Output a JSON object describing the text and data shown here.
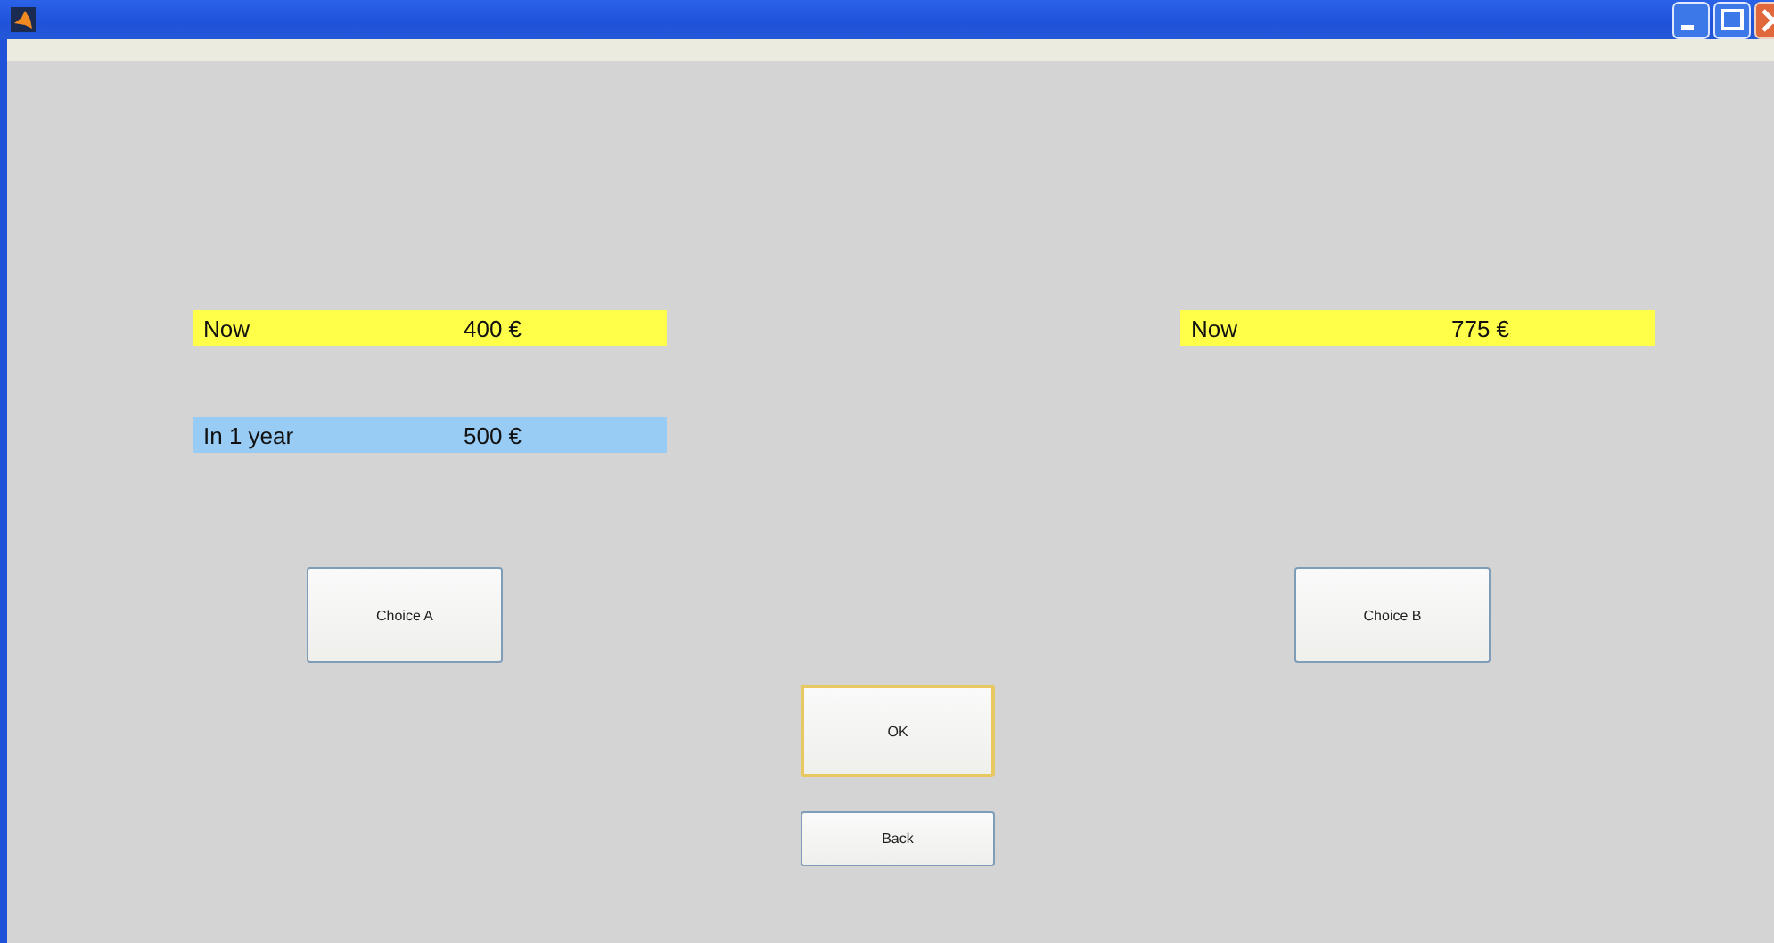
{
  "options": [
    {
      "rows": [
        {
          "label": "Now",
          "amount": "400 €",
          "color": "#ffff4a"
        },
        {
          "label": "In 1 year",
          "amount": "500 €",
          "color": "#99ccf5"
        }
      ],
      "button": "Choice A"
    },
    {
      "rows": [
        {
          "label": "Now",
          "amount": "775 €",
          "color": "#ffff4a"
        }
      ],
      "button": "Choice B"
    }
  ],
  "buttons": [
    {
      "label": "OK",
      "focused": true
    },
    {
      "label": "Back",
      "focused": false
    }
  ]
}
